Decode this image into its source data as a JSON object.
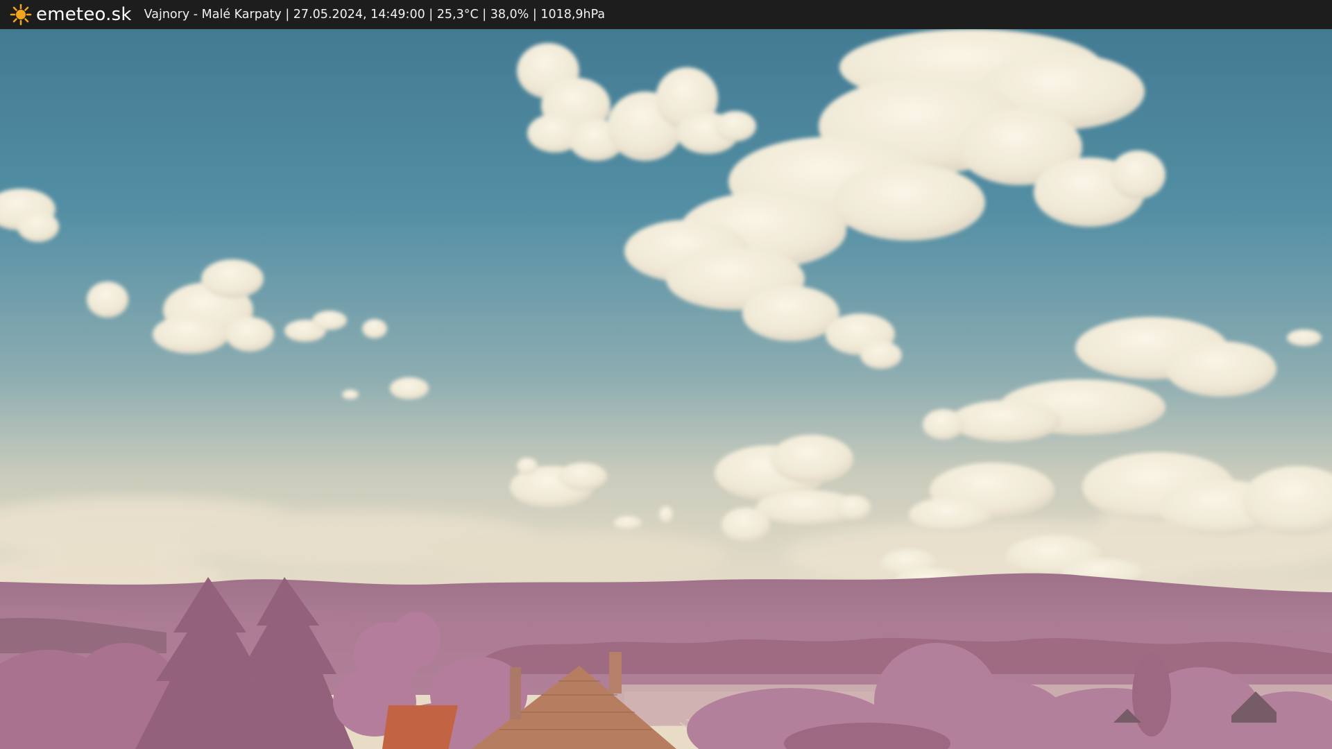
{
  "header": {
    "logo_text": "emeteo.sk",
    "logo_icon": "sun-icon",
    "location": "Vajnory - Malé Karpaty",
    "timestamp": "27.05.2024, 14:49:00",
    "temperature": "25,3°C",
    "humidity": "38,0%",
    "pressure": "1018,9hPa",
    "status_line": "Vajnory - Malé Karpaty | 27.05.2024, 14:49:00 | 25,3°C | 38,0% | 1018,9hPa"
  },
  "colors": {
    "bar_background": "#1d1d1d",
    "sun": "#f5a51c",
    "sky_top": "#3e7a96",
    "sky_horizon": "#e4dccb",
    "hills": "#9a6d89",
    "trees": "#a8708f",
    "roof": "#b5785a"
  }
}
